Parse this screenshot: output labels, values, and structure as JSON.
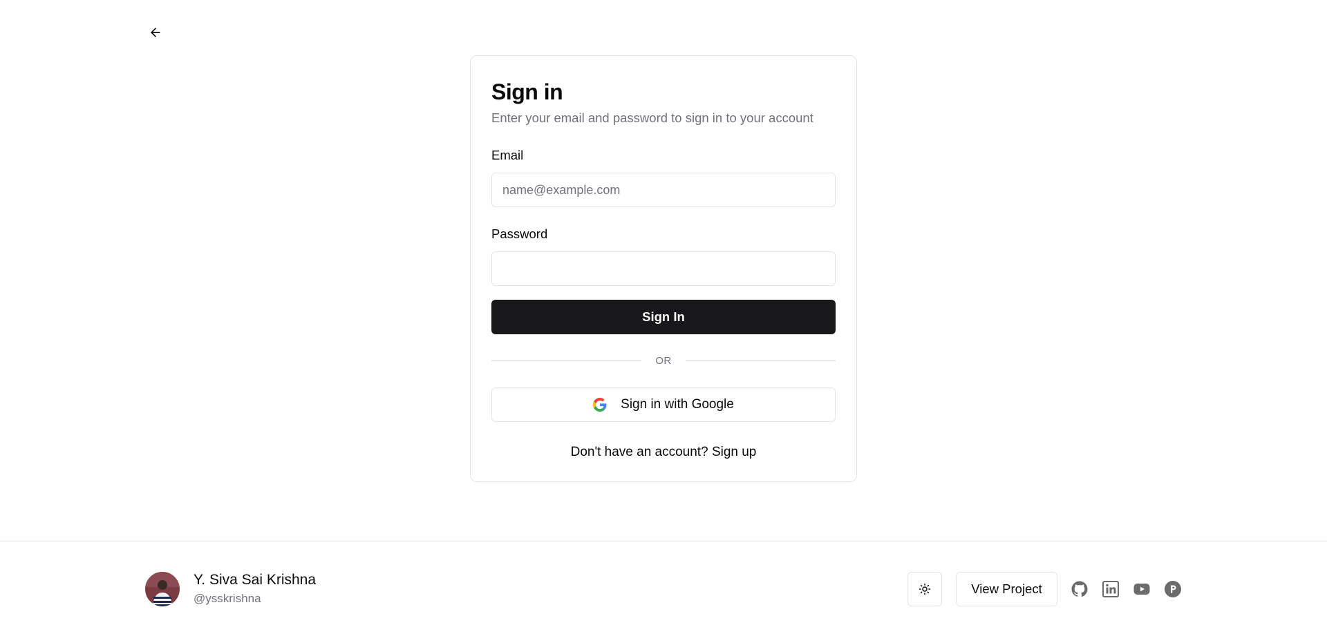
{
  "nav": {
    "back_icon": "arrow-left-icon"
  },
  "signin": {
    "title": "Sign in",
    "subtitle": "Enter your email and password to sign in to your account",
    "email_label": "Email",
    "email_placeholder": "name@example.com",
    "email_value": "",
    "password_label": "Password",
    "password_value": "",
    "submit_label": "Sign In",
    "divider_text": "OR",
    "google_label": "Sign in with Google",
    "google_icon": "google-icon",
    "signup_prompt": "Don't have an account?",
    "signup_link": "Sign up"
  },
  "footer": {
    "author_name": "Y. Siva Sai Krishna",
    "author_handle": "@ysskrishna",
    "theme_icon": "sun-icon",
    "view_project_label": "View Project",
    "social_icons": [
      "github-icon",
      "linkedin-icon",
      "youtube-icon",
      "producthunt-icon"
    ]
  },
  "colors": {
    "primary_button": "#18181b",
    "muted_text": "#71717a",
    "border": "#e4e4e7",
    "social_icon": "#6b6b6b"
  }
}
